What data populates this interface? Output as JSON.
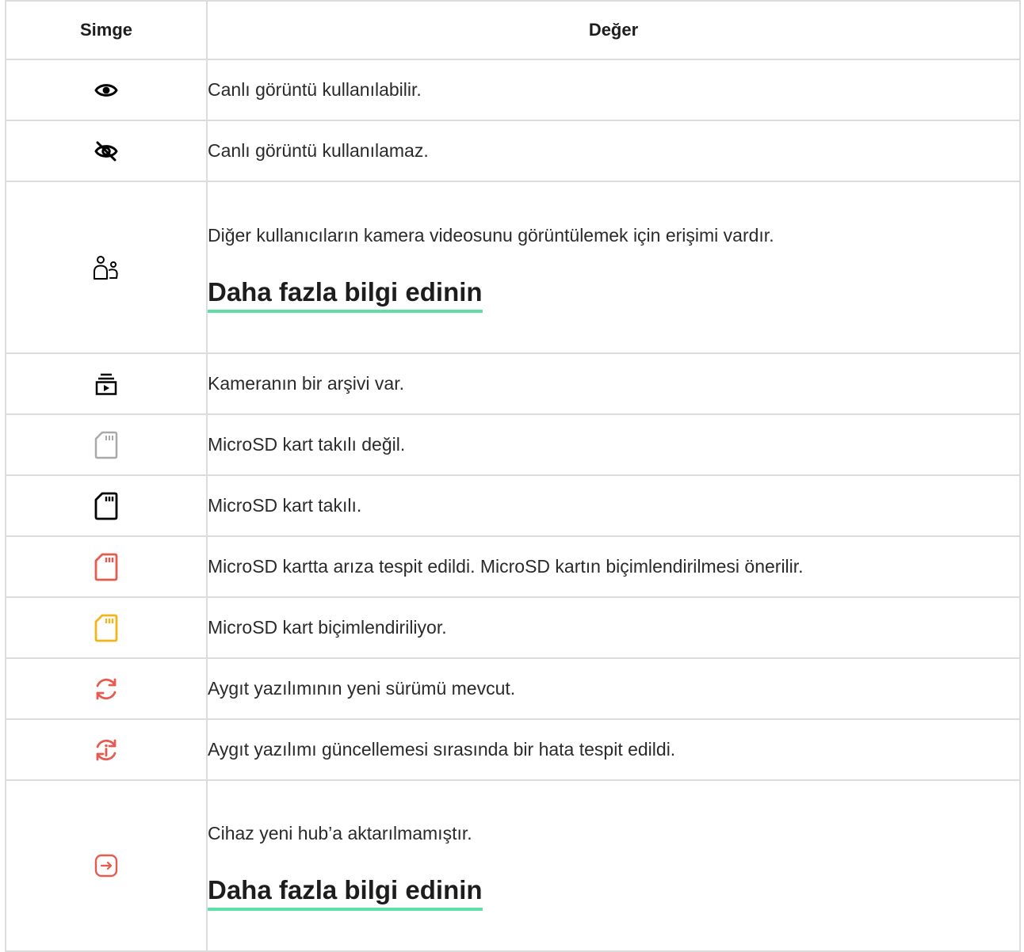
{
  "table": {
    "headers": {
      "icon": "Simge",
      "value": "Değer"
    },
    "rows": [
      {
        "icon": "eye-icon",
        "text": "Canlı görüntü kullanılabilir."
      },
      {
        "icon": "eye-off-icon",
        "text": "Canlı görüntü kullanılamaz."
      },
      {
        "icon": "users-icon",
        "text": "Diğer kullanıcıların kamera videosunu görüntülemek için erişimi vardır.",
        "link": "Daha fazla bilgi edinin"
      },
      {
        "icon": "archive-icon",
        "text": "Kameranın bir arşivi var."
      },
      {
        "icon": "sd-card-gray-icon",
        "text": "MicroSD kart takılı değil."
      },
      {
        "icon": "sd-card-black-icon",
        "text": "MicroSD kart takılı."
      },
      {
        "icon": "sd-card-red-icon",
        "text": "MicroSD kartta arıza tespit edildi. MicroSD kartın biçimlendirilmesi önerilir."
      },
      {
        "icon": "sd-card-yellow-icon",
        "text": "MicroSD kart biçimlendiriliyor."
      },
      {
        "icon": "refresh-icon",
        "text": "Aygıt yazılımının yeni sürümü mevcut."
      },
      {
        "icon": "refresh-info-icon",
        "text": "Aygıt yazılımı güncellemesi sırasında bir hata tespit edildi."
      },
      {
        "icon": "transfer-icon",
        "text": "Cihaz yeni hub’a aktarılmamıştır.",
        "link": "Daha fazla bilgi edinin"
      }
    ]
  },
  "colors": {
    "accent_green": "#5ddfa6",
    "red": "#e85a4f",
    "yellow": "#f2b41b",
    "gray": "#a9a9a9",
    "border": "#dcdcdc"
  }
}
